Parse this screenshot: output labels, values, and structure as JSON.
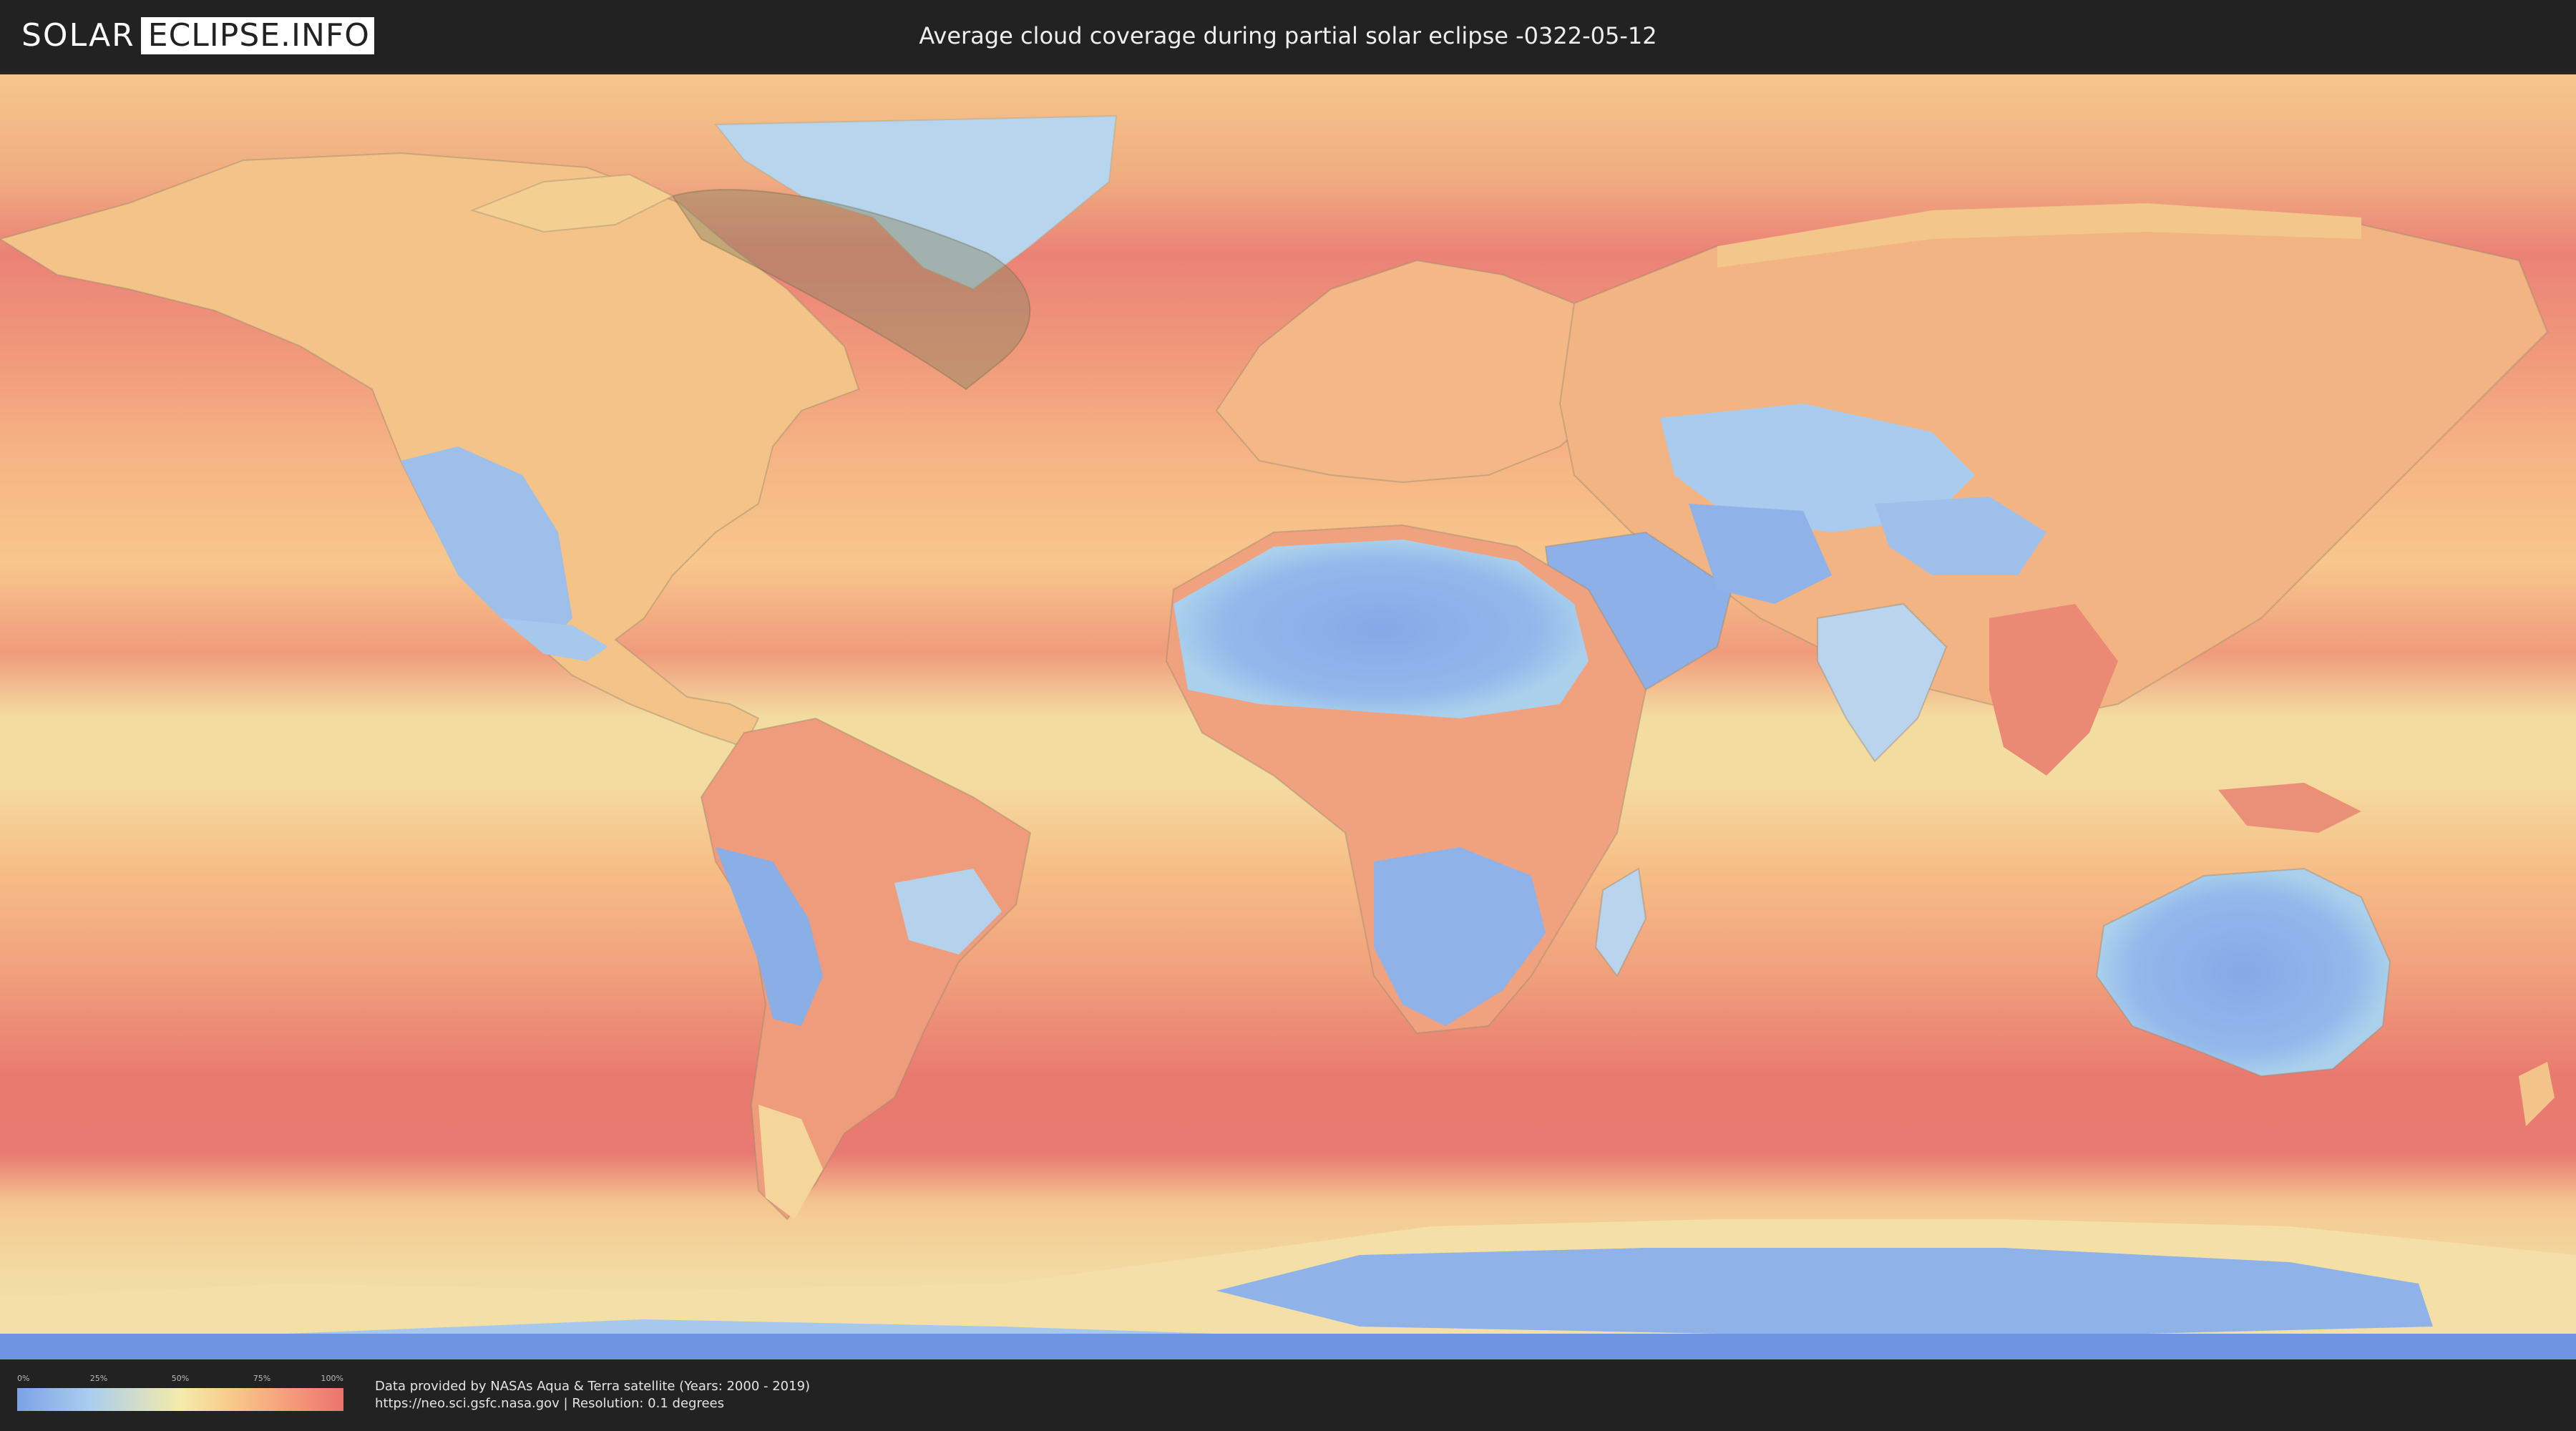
{
  "header": {
    "logo_solar": "SOLAR",
    "logo_eclipse": "ECLIPSE.INFO",
    "title": "Average cloud coverage during partial solar eclipse -0322-05-12"
  },
  "map": {
    "projection": "equirectangular",
    "layer": "average cloud coverage",
    "eclipse_region": "partial eclipse visibility over Greenland and northern Canada"
  },
  "legend": {
    "ticks": [
      "0%",
      "25%",
      "50%",
      "75%",
      "100%"
    ],
    "colors": {
      "low": "#7da2e6",
      "lowmid": "#a9cdee",
      "mid": "#f5ebab",
      "midhigh": "#f8c98a",
      "high": "#ea7470",
      "shadow": "#8a8462"
    }
  },
  "credits": {
    "line1": "Data provided by NASAs Aqua & Terra satellite (Years: 2000 - 2019)",
    "line2": "https://neo.sci.gsfc.nasa.gov | Resolution: 0.1 degrees"
  }
}
